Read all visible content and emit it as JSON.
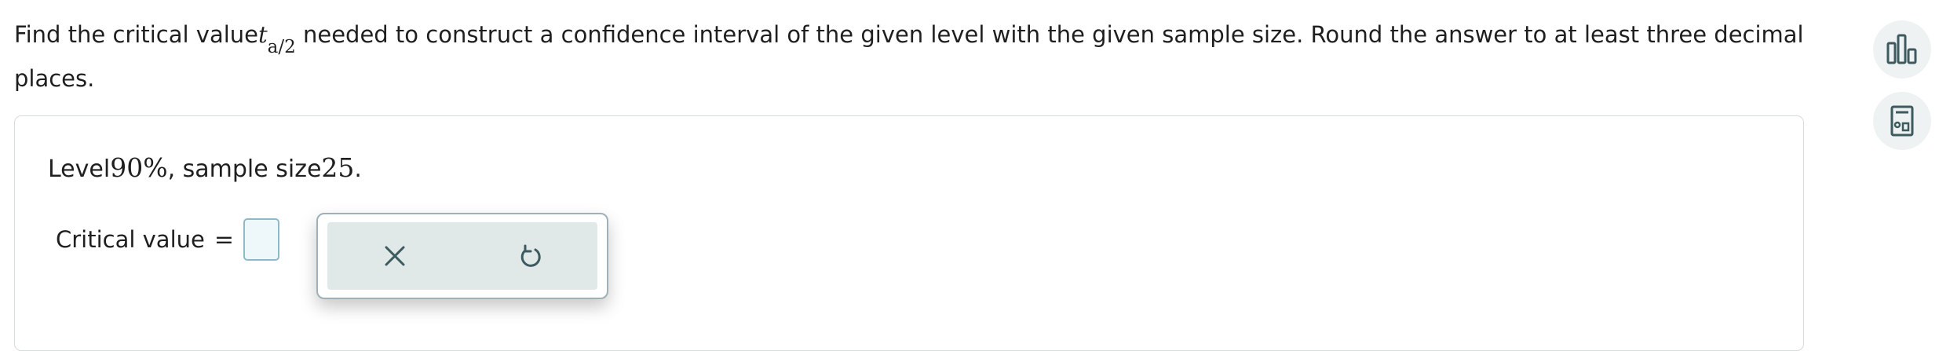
{
  "question": {
    "text_before": "Find the critical value",
    "var_symbol": "t",
    "var_subscript": "a/2",
    "text_after": " needed to construct a confidence interval of the given level with the given sample size. Round the answer to at least three decimal places."
  },
  "side_tools": {
    "chart_icon": "bar-chart-icon",
    "calculator_icon": "calculator-icon"
  },
  "problem": {
    "level_label": "Level",
    "level_value": "90%",
    "sep": ", sample size",
    "sample_value": "25",
    "end": "."
  },
  "answer": {
    "label": "Critical value",
    "equals": "=",
    "value": ""
  },
  "tools": {
    "clear_icon": "close-icon",
    "undo_icon": "undo-icon"
  },
  "colors": {
    "accent": "#2a7d8c",
    "icon": "#3d5a5f",
    "input_border": "#8fb8c8",
    "input_bg": "#eef8fb"
  }
}
